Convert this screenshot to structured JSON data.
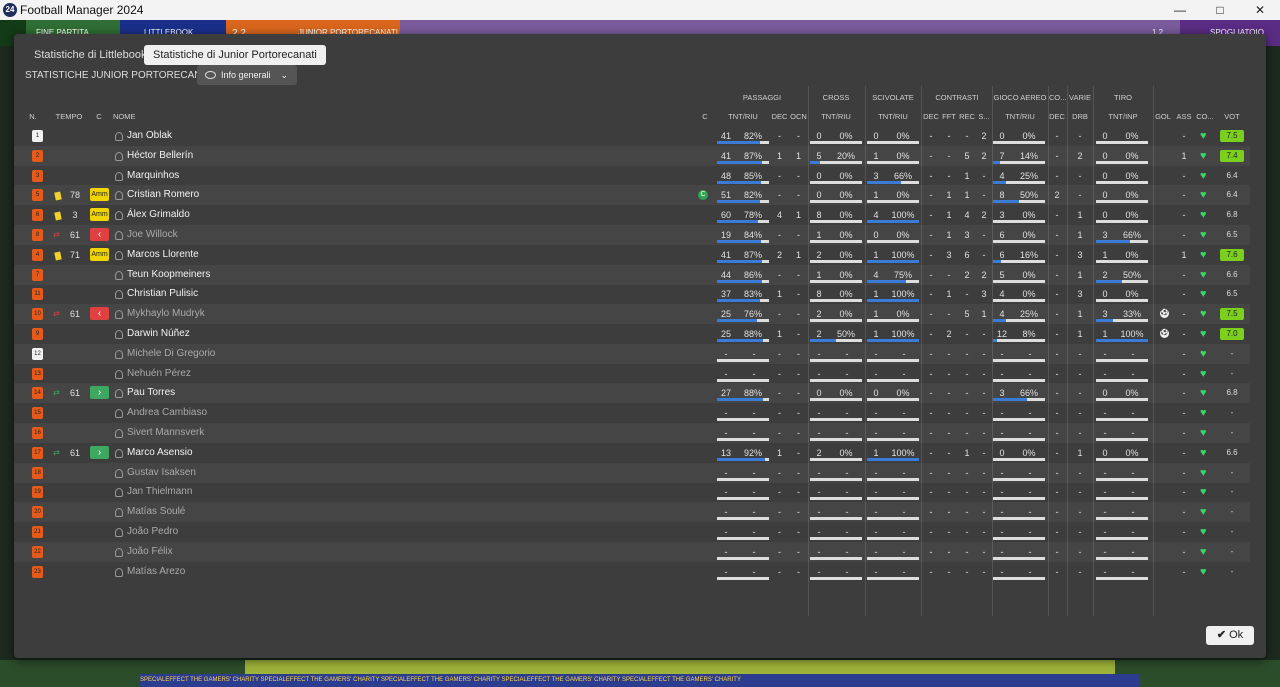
{
  "app": {
    "title": "Football Manager 2024",
    "icon_glyph": "24"
  },
  "window_buttons": [
    "—",
    "□",
    "✕"
  ],
  "background": {
    "left_text": "FINE PARTITA",
    "home_team": "LITTLEBOOK",
    "score": "2  2",
    "away_team": "JUNIOR PORTORECANATI",
    "right_text": "SPOGLIATOIO",
    "right_score": "1  2",
    "ads": "SPECIALEFFECT THE GAMERS' CHARITY   SPECIALEFFECT THE GAMERS' CHARITY   SPECIALEFFECT THE GAMERS' CHARITY   SPECIALEFFECT THE GAMERS' CHARITY   SPECIALEFFECT THE GAMERS' CHARITY"
  },
  "tabs": [
    {
      "label": "Statistiche di Littlebook",
      "active": false
    },
    {
      "label": "Statistiche di Junior Portorecanati",
      "active": true
    }
  ],
  "subtitle": "STATISTICHE JUNIOR PORTORECANATI",
  "view_dropdown": {
    "label": "Info generali",
    "chevron": "⌄"
  },
  "ok_button": {
    "label": "Ok",
    "check": "✔"
  },
  "group_headers": {
    "passaggi": "PASSAGGI",
    "cross": "CROSS",
    "scivolate": "SCIVOLATE",
    "contrasti": "CONTRASTI",
    "gioco_aereo": "GIOCO AEREO",
    "co": "CO...",
    "varie": "VARIE",
    "tiro": "TIRO"
  },
  "column_headers": {
    "n": "N.",
    "tempo": "TEMPO",
    "c": "C",
    "nome": "NOME",
    "cap": "C",
    "pass_tnt": "TNT/RIU",
    "pass_dec": "DEC",
    "pass_ocn": "OCN",
    "cross_tnt": "TNT/RIU",
    "sciv_tnt": "TNT/RIU",
    "contr_dec": "DEC",
    "contr_fft": "FFT",
    "contr_rec": "REC",
    "contr_s": "S...",
    "aereo_tnt": "TNT/RIU",
    "co_dec": "DEC",
    "varie_drb": "DRB",
    "tiro_tnt": "TNT/INP",
    "gol": "GOL",
    "ass": "ASS",
    "co2": "CO...",
    "vot": "VOT"
  },
  "players": [
    {
      "n": "1",
      "gk": true,
      "min": "",
      "card": "",
      "tag": "",
      "name": "Jan Oblak",
      "sub": false,
      "pass": "41",
      "pass_pct": "82%",
      "pass_fill": 0.82,
      "pass_dec": "-",
      "pass_ocn": "-",
      "cross": "0",
      "cross_pct": "0%",
      "cross_fill": 0,
      "sciv": "0",
      "sciv_pct": "0%",
      "sciv_fill": 0,
      "c_dec": "-",
      "c_fft": "-",
      "c_rec": "-",
      "c_s": "2",
      "aereo": "0",
      "aereo_pct": "0%",
      "aereo_fill": 0,
      "co_dec": "-",
      "drb": "-",
      "tiro": "0",
      "tiro_pct": "0%",
      "tiro_fill": 0,
      "gol": "",
      "ass": "-",
      "vot": "7.5",
      "vot_good": true,
      "capt": false,
      "ball": false
    },
    {
      "n": "2",
      "gk": false,
      "min": "",
      "card": "",
      "tag": "",
      "name": "Héctor Bellerín",
      "sub": false,
      "pass": "41",
      "pass_pct": "87%",
      "pass_fill": 0.87,
      "pass_dec": "1",
      "pass_ocn": "1",
      "cross": "5",
      "cross_pct": "20%",
      "cross_fill": 0.2,
      "sciv": "1",
      "sciv_pct": "0%",
      "sciv_fill": 0,
      "c_dec": "-",
      "c_fft": "-",
      "c_rec": "5",
      "c_s": "2",
      "aereo": "7",
      "aereo_pct": "14%",
      "aereo_fill": 0.14,
      "co_dec": "-",
      "drb": "2",
      "tiro": "0",
      "tiro_pct": "0%",
      "tiro_fill": 0,
      "gol": "",
      "ass": "1",
      "vot": "7.4",
      "vot_good": true,
      "capt": false,
      "ball": false
    },
    {
      "n": "3",
      "gk": false,
      "min": "",
      "card": "",
      "tag": "",
      "name": "Marquinhos",
      "sub": false,
      "pass": "48",
      "pass_pct": "85%",
      "pass_fill": 0.85,
      "pass_dec": "-",
      "pass_ocn": "-",
      "cross": "0",
      "cross_pct": "0%",
      "cross_fill": 0,
      "sciv": "3",
      "sciv_pct": "66%",
      "sciv_fill": 0.66,
      "c_dec": "-",
      "c_fft": "-",
      "c_rec": "1",
      "c_s": "-",
      "aereo": "4",
      "aereo_pct": "25%",
      "aereo_fill": 0.25,
      "co_dec": "-",
      "drb": "-",
      "tiro": "0",
      "tiro_pct": "0%",
      "tiro_fill": 0,
      "gol": "",
      "ass": "-",
      "vot": "6.4",
      "vot_good": false,
      "capt": false,
      "ball": false
    },
    {
      "n": "5",
      "gk": false,
      "min": "78",
      "card": "yellow",
      "tag": "Amm",
      "name": "Cristian Romero",
      "sub": false,
      "pass": "51",
      "pass_pct": "82%",
      "pass_fill": 0.82,
      "pass_dec": "-",
      "pass_ocn": "-",
      "cross": "0",
      "cross_pct": "0%",
      "cross_fill": 0,
      "sciv": "1",
      "sciv_pct": "0%",
      "sciv_fill": 0,
      "c_dec": "-",
      "c_fft": "1",
      "c_rec": "1",
      "c_s": "-",
      "aereo": "8",
      "aereo_pct": "50%",
      "aereo_fill": 0.5,
      "co_dec": "2",
      "drb": "-",
      "tiro": "0",
      "tiro_pct": "0%",
      "tiro_fill": 0,
      "gol": "",
      "ass": "-",
      "vot": "6.4",
      "vot_good": false,
      "capt": true,
      "ball": false
    },
    {
      "n": "6",
      "gk": false,
      "min": "3",
      "card": "yellow",
      "tag": "Amm",
      "name": "Álex Grimaldo",
      "sub": false,
      "pass": "60",
      "pass_pct": "78%",
      "pass_fill": 0.78,
      "pass_dec": "4",
      "pass_ocn": "1",
      "cross": "8",
      "cross_pct": "0%",
      "cross_fill": 0,
      "sciv": "4",
      "sciv_pct": "100%",
      "sciv_fill": 1,
      "c_dec": "-",
      "c_fft": "1",
      "c_rec": "4",
      "c_s": "2",
      "aereo": "3",
      "aereo_pct": "0%",
      "aereo_fill": 0,
      "co_dec": "-",
      "drb": "1",
      "tiro": "0",
      "tiro_pct": "0%",
      "tiro_fill": 0,
      "gol": "",
      "ass": "-",
      "vot": "6.8",
      "vot_good": false,
      "capt": false,
      "ball": false
    },
    {
      "n": "8",
      "gk": false,
      "min": "61",
      "card": "",
      "tag": "out",
      "name": "Joe Willock",
      "sub": true,
      "pass": "19",
      "pass_pct": "84%",
      "pass_fill": 0.84,
      "pass_dec": "-",
      "pass_ocn": "-",
      "cross": "1",
      "cross_pct": "0%",
      "cross_fill": 0,
      "sciv": "0",
      "sciv_pct": "0%",
      "sciv_fill": 0,
      "c_dec": "-",
      "c_fft": "1",
      "c_rec": "3",
      "c_s": "-",
      "aereo": "6",
      "aereo_pct": "0%",
      "aereo_fill": 0,
      "co_dec": "-",
      "drb": "1",
      "tiro": "3",
      "tiro_pct": "66%",
      "tiro_fill": 0.66,
      "gol": "",
      "ass": "-",
      "vot": "6.5",
      "vot_good": false,
      "capt": false,
      "ball": false
    },
    {
      "n": "4",
      "gk": false,
      "min": "71",
      "card": "yellow",
      "tag": "Amm",
      "name": "Marcos Llorente",
      "sub": false,
      "pass": "41",
      "pass_pct": "87%",
      "pass_fill": 0.87,
      "pass_dec": "2",
      "pass_ocn": "1",
      "cross": "2",
      "cross_pct": "0%",
      "cross_fill": 0,
      "sciv": "1",
      "sciv_pct": "100%",
      "sciv_fill": 1,
      "c_dec": "-",
      "c_fft": "3",
      "c_rec": "6",
      "c_s": "-",
      "aereo": "6",
      "aereo_pct": "16%",
      "aereo_fill": 0.16,
      "co_dec": "-",
      "drb": "3",
      "tiro": "1",
      "tiro_pct": "0%",
      "tiro_fill": 0,
      "gol": "",
      "ass": "1",
      "vot": "7.6",
      "vot_good": true,
      "capt": false,
      "ball": false
    },
    {
      "n": "7",
      "gk": false,
      "min": "",
      "card": "",
      "tag": "",
      "name": "Teun Koopmeiners",
      "sub": false,
      "pass": "44",
      "pass_pct": "86%",
      "pass_fill": 0.86,
      "pass_dec": "-",
      "pass_ocn": "-",
      "cross": "1",
      "cross_pct": "0%",
      "cross_fill": 0,
      "sciv": "4",
      "sciv_pct": "75%",
      "sciv_fill": 0.75,
      "c_dec": "-",
      "c_fft": "-",
      "c_rec": "2",
      "c_s": "2",
      "aereo": "5",
      "aereo_pct": "0%",
      "aereo_fill": 0,
      "co_dec": "-",
      "drb": "1",
      "tiro": "2",
      "tiro_pct": "50%",
      "tiro_fill": 0.5,
      "gol": "",
      "ass": "-",
      "vot": "6.6",
      "vot_good": false,
      "capt": false,
      "ball": false
    },
    {
      "n": "11",
      "gk": false,
      "min": "",
      "card": "",
      "tag": "",
      "name": "Christian Pulisic",
      "sub": false,
      "pass": "37",
      "pass_pct": "83%",
      "pass_fill": 0.83,
      "pass_dec": "1",
      "pass_ocn": "-",
      "cross": "8",
      "cross_pct": "0%",
      "cross_fill": 0,
      "sciv": "1",
      "sciv_pct": "100%",
      "sciv_fill": 1,
      "c_dec": "-",
      "c_fft": "1",
      "c_rec": "-",
      "c_s": "3",
      "aereo": "4",
      "aereo_pct": "0%",
      "aereo_fill": 0,
      "co_dec": "-",
      "drb": "3",
      "tiro": "0",
      "tiro_pct": "0%",
      "tiro_fill": 0,
      "gol": "",
      "ass": "-",
      "vot": "6.5",
      "vot_good": false,
      "capt": false,
      "ball": false
    },
    {
      "n": "10",
      "gk": false,
      "min": "61",
      "card": "",
      "tag": "out",
      "name": "Mykhaylo Mudryk",
      "sub": true,
      "pass": "25",
      "pass_pct": "76%",
      "pass_fill": 0.76,
      "pass_dec": "-",
      "pass_ocn": "-",
      "cross": "2",
      "cross_pct": "0%",
      "cross_fill": 0,
      "sciv": "1",
      "sciv_pct": "0%",
      "sciv_fill": 0,
      "c_dec": "-",
      "c_fft": "-",
      "c_rec": "5",
      "c_s": "1",
      "aereo": "4",
      "aereo_pct": "25%",
      "aereo_fill": 0.25,
      "co_dec": "-",
      "drb": "1",
      "tiro": "3",
      "tiro_pct": "33%",
      "tiro_fill": 0.33,
      "gol": "",
      "ass": "-",
      "vot": "7.5",
      "vot_good": true,
      "capt": false,
      "ball": true
    },
    {
      "n": "9",
      "gk": false,
      "min": "",
      "card": "",
      "tag": "",
      "name": "Darwin Núñez",
      "sub": false,
      "pass": "25",
      "pass_pct": "88%",
      "pass_fill": 0.88,
      "pass_dec": "1",
      "pass_ocn": "-",
      "cross": "2",
      "cross_pct": "50%",
      "cross_fill": 0.5,
      "sciv": "1",
      "sciv_pct": "100%",
      "sciv_fill": 1,
      "c_dec": "-",
      "c_fft": "2",
      "c_rec": "-",
      "c_s": "-",
      "aereo": "12",
      "aereo_pct": "8%",
      "aereo_fill": 0.08,
      "co_dec": "-",
      "drb": "1",
      "tiro": "1",
      "tiro_pct": "100%",
      "tiro_fill": 1,
      "gol": "",
      "ass": "-",
      "vot": "7.0",
      "vot_good": true,
      "capt": false,
      "ball": true
    },
    {
      "n": "12",
      "gk": true,
      "min": "",
      "card": "",
      "tag": "",
      "name": "Michele Di Gregorio",
      "sub": true,
      "empty": true,
      "vot": "-"
    },
    {
      "n": "13",
      "gk": false,
      "min": "",
      "card": "",
      "tag": "",
      "name": "Nehuén Pérez",
      "sub": true,
      "empty": true,
      "vot": "-"
    },
    {
      "n": "14",
      "gk": false,
      "min": "61",
      "card": "",
      "tag": "in",
      "name": "Pau Torres",
      "sub": false,
      "pass": "27",
      "pass_pct": "88%",
      "pass_fill": 0.88,
      "pass_dec": "-",
      "pass_ocn": "-",
      "cross": "0",
      "cross_pct": "0%",
      "cross_fill": 0,
      "sciv": "0",
      "sciv_pct": "0%",
      "sciv_fill": 0,
      "c_dec": "-",
      "c_fft": "-",
      "c_rec": "-",
      "c_s": "-",
      "aereo": "3",
      "aereo_pct": "66%",
      "aereo_fill": 0.66,
      "co_dec": "-",
      "drb": "-",
      "tiro": "0",
      "tiro_pct": "0%",
      "tiro_fill": 0,
      "gol": "",
      "ass": "-",
      "vot": "6.8",
      "vot_good": false,
      "capt": false,
      "ball": false
    },
    {
      "n": "15",
      "gk": false,
      "min": "",
      "card": "",
      "tag": "",
      "name": "Andrea Cambiaso",
      "sub": true,
      "empty": true,
      "vot": "-"
    },
    {
      "n": "16",
      "gk": false,
      "min": "",
      "card": "",
      "tag": "",
      "name": "Sivert Mannsverk",
      "sub": true,
      "empty": true,
      "vot": "-"
    },
    {
      "n": "17",
      "gk": false,
      "min": "61",
      "card": "",
      "tag": "in",
      "name": "Marco Asensio",
      "sub": false,
      "pass": "13",
      "pass_pct": "92%",
      "pass_fill": 0.92,
      "pass_dec": "1",
      "pass_ocn": "-",
      "cross": "2",
      "cross_pct": "0%",
      "cross_fill": 0,
      "sciv": "1",
      "sciv_pct": "100%",
      "sciv_fill": 1,
      "c_dec": "-",
      "c_fft": "-",
      "c_rec": "1",
      "c_s": "-",
      "aereo": "0",
      "aereo_pct": "0%",
      "aereo_fill": 0,
      "co_dec": "-",
      "drb": "1",
      "tiro": "0",
      "tiro_pct": "0%",
      "tiro_fill": 0,
      "gol": "",
      "ass": "-",
      "vot": "6.6",
      "vot_good": false,
      "capt": false,
      "ball": false
    },
    {
      "n": "18",
      "gk": false,
      "min": "",
      "card": "",
      "tag": "",
      "name": "Gustav Isaksen",
      "sub": true,
      "empty": true,
      "vot": "-"
    },
    {
      "n": "19",
      "gk": false,
      "min": "",
      "card": "",
      "tag": "",
      "name": "Jan Thielmann",
      "sub": true,
      "empty": true,
      "vot": "-"
    },
    {
      "n": "20",
      "gk": false,
      "min": "",
      "card": "",
      "tag": "",
      "name": "Matías Soulé",
      "sub": true,
      "empty": true,
      "vot": "-"
    },
    {
      "n": "21",
      "gk": false,
      "min": "",
      "card": "",
      "tag": "",
      "name": "João Pedro",
      "sub": true,
      "empty": true,
      "vot": "-"
    },
    {
      "n": "22",
      "gk": false,
      "min": "",
      "card": "",
      "tag": "",
      "name": "João Félix",
      "sub": true,
      "empty": true,
      "vot": "-"
    },
    {
      "n": "23",
      "gk": false,
      "min": "",
      "card": "",
      "tag": "",
      "name": "Matías Arezo",
      "sub": true,
      "empty": true,
      "vot": "-"
    }
  ],
  "colors": {
    "accent": "#3a7bd5",
    "good_rating": "#7bd01e",
    "heart": "#39d667",
    "shirt": "#e55a1a"
  }
}
